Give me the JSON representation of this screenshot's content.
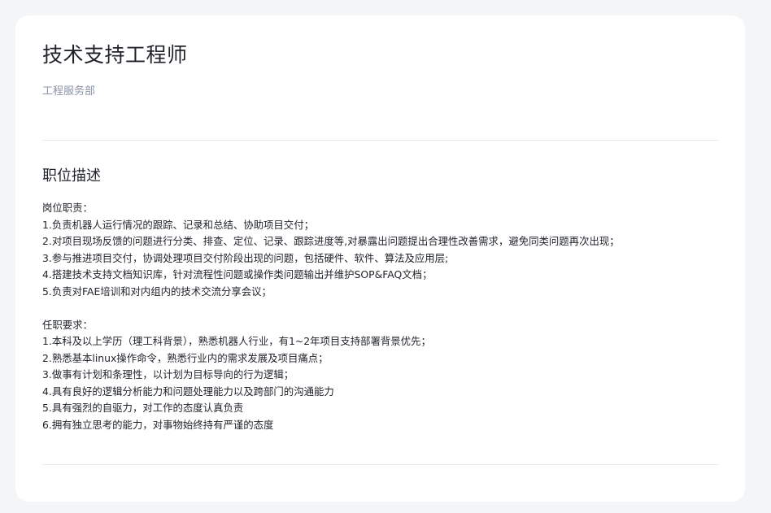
{
  "job": {
    "title": "技术支持工程师",
    "department": "工程服务部"
  },
  "description": {
    "heading": "职位描述",
    "responsibilities": {
      "label": "岗位职责：",
      "items": [
        "1.负责机器人运行情况的跟踪、记录和总结、协助项目交付；",
        "2.对项目现场反馈的问题进行分类、排查、定位、记录、跟踪进度等,对暴露出问题提出合理性改善需求，避免同类问题再次出现；",
        "3.参与推进项目交付，协调处理项目交付阶段出现的问题，包括硬件、软件、算法及应用层;",
        "4.搭建技术支持文档知识库，针对流程性问题或操作类问题输出并维护SOP&FAQ文档；",
        "5.负责对FAE培训和对内组内的技术交流分享会议；"
      ]
    },
    "requirements": {
      "label": "任职要求：",
      "items": [
        "1.本科及以上学历（理工科背景），熟悉机器人行业，有1~2年项目支持部署背景优先；",
        "2.熟悉基本linux操作命令，熟悉行业内的需求发展及项目痛点；",
        "3.做事有计划和条理性，以计划为目标导向的行为逻辑；",
        "4.具有良好的逻辑分析能力和问题处理能力以及跨部门的沟通能力",
        "5.具有强烈的自驱力，对工作的态度认真负责",
        "6.拥有独立思考的能力，对事物始终持有严谨的态度"
      ]
    }
  }
}
